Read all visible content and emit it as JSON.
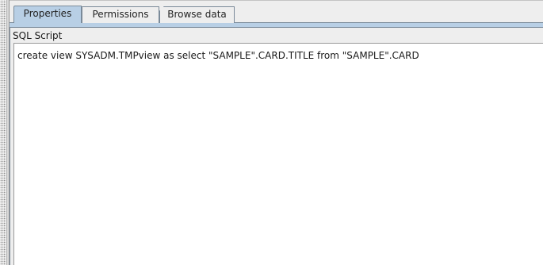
{
  "tabs": [
    {
      "label": "Properties",
      "selected": true
    },
    {
      "label": "Permissions",
      "selected": false
    },
    {
      "label": "Browse data",
      "selected": false
    }
  ],
  "sql_panel": {
    "label": "SQL Script",
    "script": "create view SYSADM.TMPview as select \"SAMPLE\".CARD.TITLE from \"SAMPLE\".CARD"
  },
  "colors": {
    "selected_tab": "#b8cfe5",
    "panel_background": "#eeeeee",
    "editor_background": "#ffffff",
    "border": "#7a8a99"
  }
}
